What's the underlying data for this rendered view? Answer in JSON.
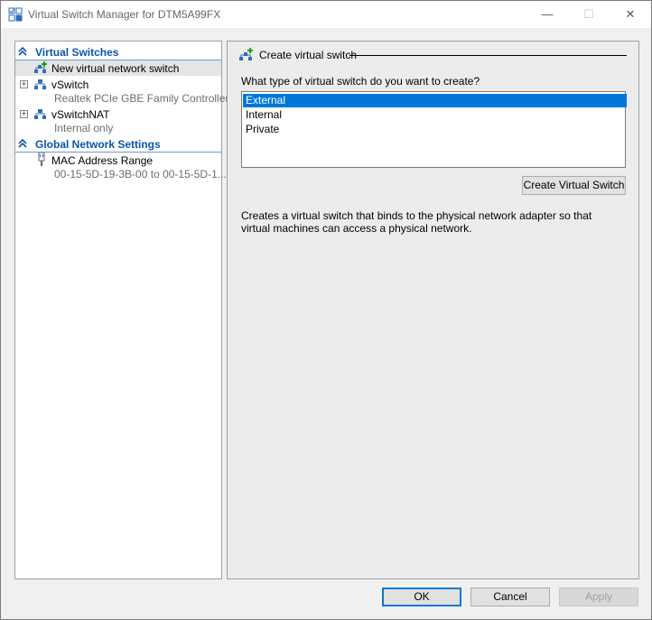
{
  "window": {
    "title": "Virtual Switch Manager for DTM5A99FX",
    "minimize_glyph": "—",
    "maximize_glyph": "☐",
    "close_glyph": "✕"
  },
  "sidebar": {
    "sections": [
      {
        "label": "Virtual Switches",
        "icon": "chevron-up-double-icon"
      },
      {
        "label": "Global Network Settings",
        "icon": "chevron-up-double-icon"
      }
    ],
    "items": [
      {
        "label": "New virtual network switch",
        "icon": "add-network-switch-icon",
        "selected": true
      },
      {
        "label": "vSwitch",
        "sublabel": "Realtek PCIe GBE Family Controller",
        "expander": "+",
        "icon": "network-switch-icon"
      },
      {
        "label": "vSwitchNAT",
        "sublabel": "Internal only",
        "expander": "+",
        "icon": "network-switch-icon"
      },
      {
        "label": "MAC Address Range",
        "sublabel": "00-15-5D-19-3B-00 to 00-15-5D-1...",
        "icon": "network-plug-icon"
      }
    ]
  },
  "main": {
    "heading": "Create virtual switch",
    "question": "What type of virtual switch do you want to create?",
    "options": [
      "External",
      "Internal",
      "Private"
    ],
    "selected_option": "External",
    "create_button": "Create Virtual Switch",
    "description": "Creates a virtual switch that binds to the physical network adapter so that virtual machines can access a physical network."
  },
  "footer": {
    "ok": "OK",
    "cancel": "Cancel",
    "apply": "Apply"
  },
  "colors": {
    "accent": "#0078d7",
    "section_header": "#0b56a8"
  }
}
